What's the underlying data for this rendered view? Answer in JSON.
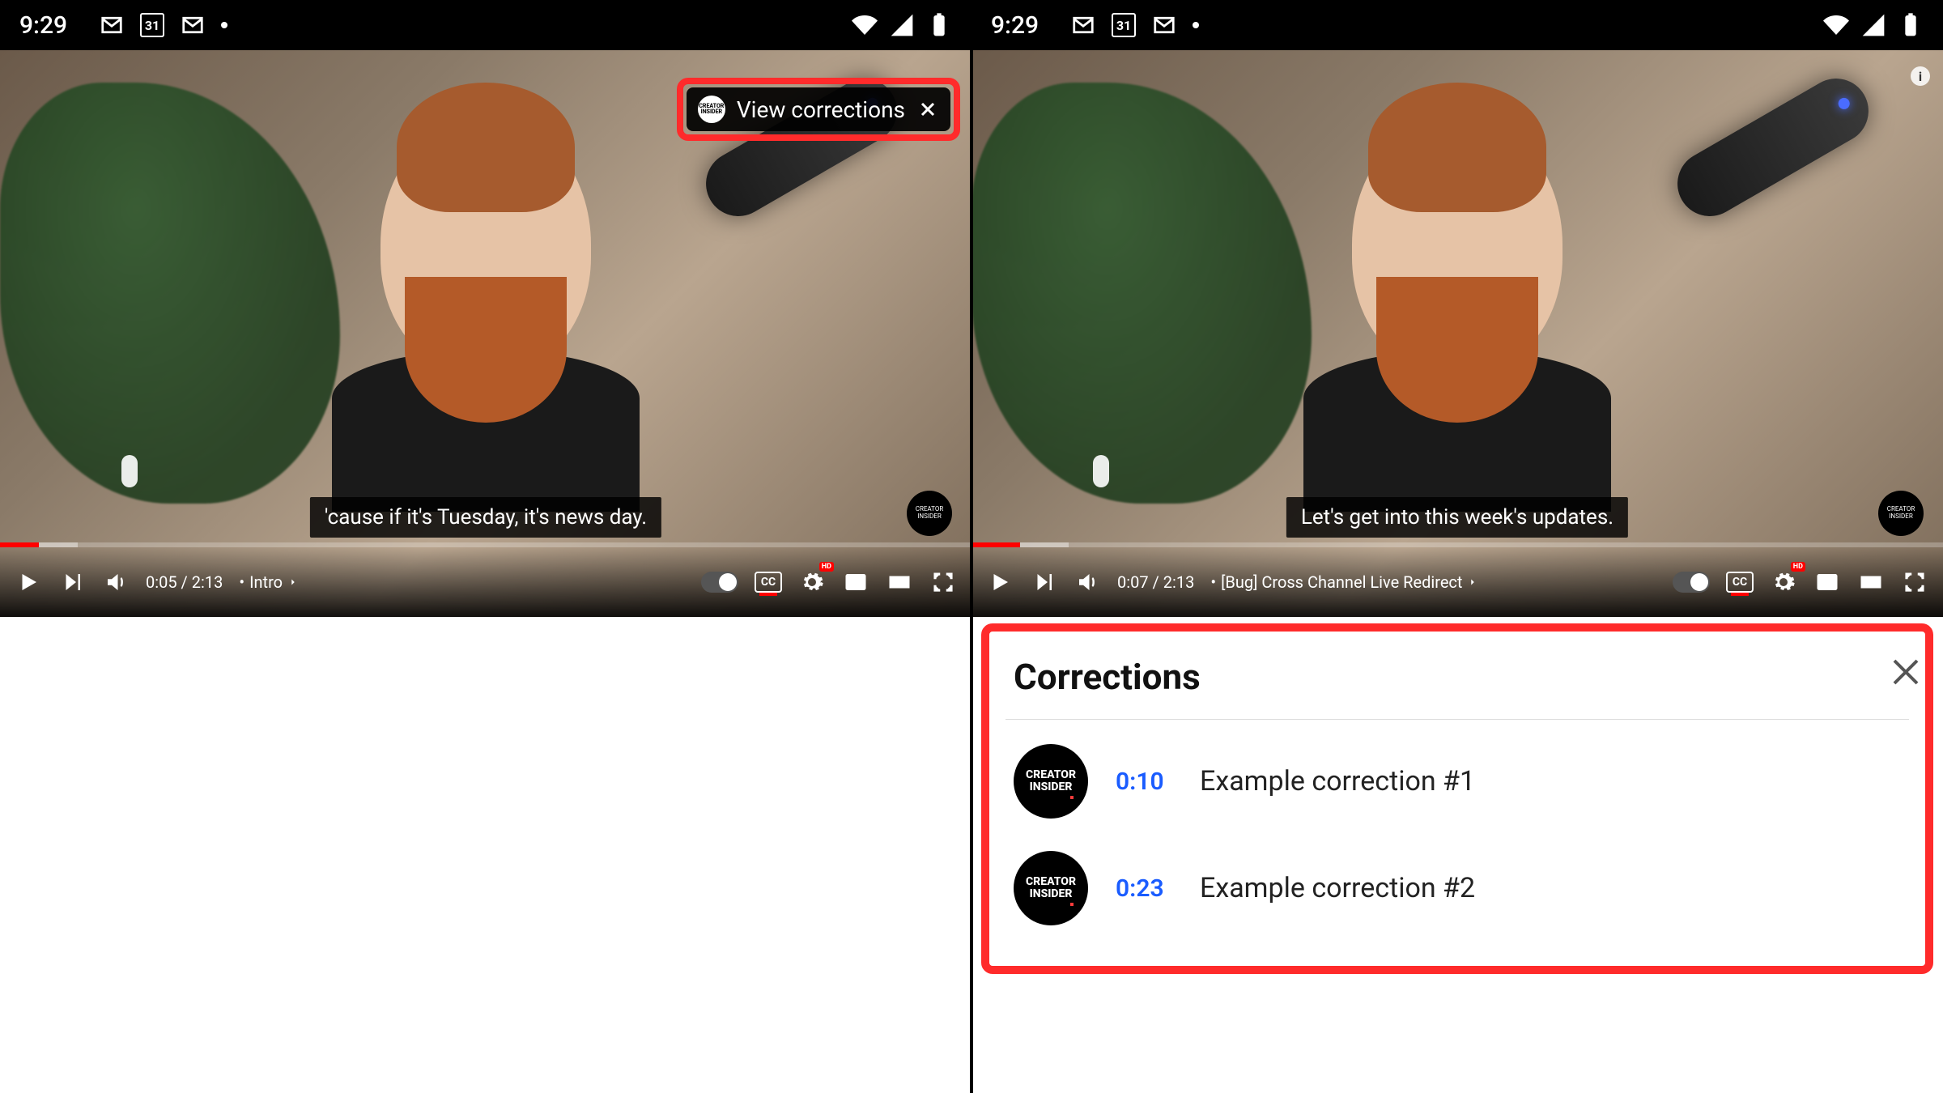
{
  "statusbar": {
    "time": "9:29",
    "cal_day": "31"
  },
  "left": {
    "caption": "'cause if it's Tuesday, it's news day.",
    "view_corrections_label": "View corrections",
    "chip_avatar_text": "CREATOR INSIDER",
    "time": "0:05 / 2:13",
    "chapter": "Intro",
    "badge": "CREATOR INSIDER",
    "progress_played_pct": 4,
    "progress_loaded_pct": 8
  },
  "right": {
    "caption": "Let's get into this week's updates.",
    "time": "0:07 / 2:13",
    "chapter": "[Bug] Cross Channel Live Redirect",
    "badge": "CREATOR INSIDER",
    "progress_played_pct": 5,
    "progress_loaded_pct": 10
  },
  "corrections": {
    "title": "Corrections",
    "avatar_line1": "CREATOR",
    "avatar_line2": "INSIDER",
    "items": [
      {
        "ts": "0:10",
        "text": "Example correction #1"
      },
      {
        "ts": "0:23",
        "text": "Example correction #2"
      }
    ]
  },
  "settings_hd": "HD"
}
